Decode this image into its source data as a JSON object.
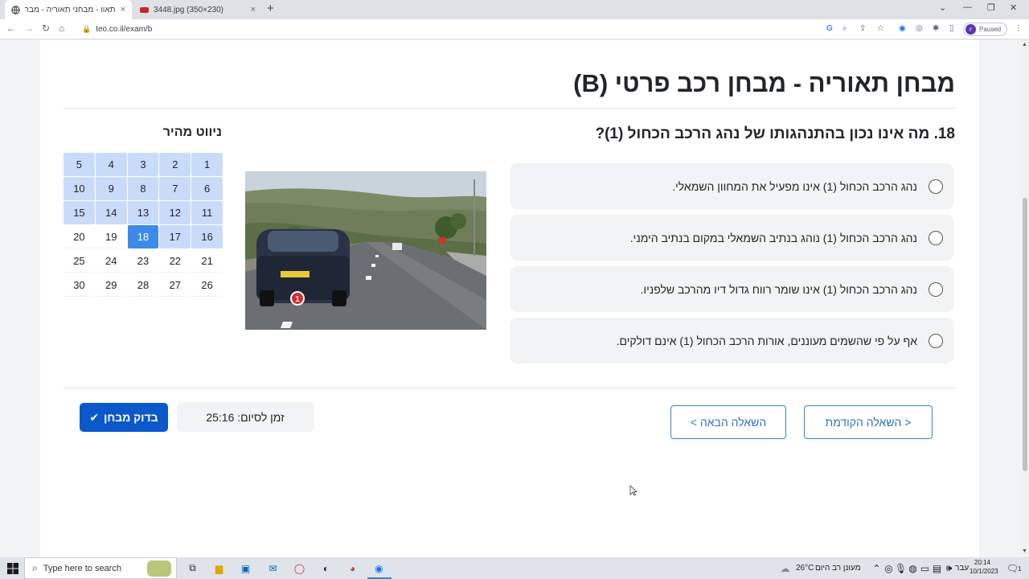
{
  "browser": {
    "tabs": [
      {
        "title": "תאוו - מבחני תאוריה - מבחן רכב",
        "close": "×"
      },
      {
        "title": "3448.jpg (350×230)",
        "close": "×"
      }
    ],
    "new_tab": "+",
    "url": "teo.co.il/exam/b",
    "profile_initial": "r",
    "profile_status": "Paused"
  },
  "page": {
    "title": "מבחן תאוריה - מבחן רכב פרטי (B)",
    "question": "18. מה אינו נכון בהתנהגותו של נהג הרכב הכחול (1)?",
    "answers": [
      "נהג הרכב הכחול (1) אינו מפעיל את המחוון השמאלי.",
      "נהג הרכב הכחול (1) נוהג בנתיב השמאלי במקום בנתיב הימני.",
      "נהג הרכב הכחול (1) אינו שומר רווח גדול דיו מהרכב שלפניו.",
      "אף על פי שהשמים מעוננים, אורות הרכב הכחול (1) אינם דולקים."
    ],
    "image_marker": "1",
    "quick_nav_title": "ניווט מהיר",
    "quick_nav": [
      [
        "1",
        "2",
        "3",
        "4",
        "5"
      ],
      [
        "6",
        "7",
        "8",
        "9",
        "10"
      ],
      [
        "11",
        "12",
        "13",
        "14",
        "15"
      ],
      [
        "16",
        "17",
        "18",
        "19",
        "20"
      ],
      [
        "21",
        "22",
        "23",
        "24",
        "25"
      ],
      [
        "26",
        "27",
        "28",
        "29",
        "30"
      ]
    ],
    "current_question": 18,
    "answered_through": 17,
    "prev_button": "< השאלה הקודמת",
    "next_button": "השאלה הבאה >",
    "timer": "זמן לסיום: 25:16",
    "check_button": "בדוק מבחן"
  },
  "taskbar": {
    "search_placeholder": "Type here to search",
    "weather_temp": "26°C",
    "weather_text": "מעונן רב היום",
    "lang": "עבר",
    "time": "20:14",
    "date": "10/1/2023",
    "notifications": "1"
  },
  "colors": {
    "primary": "#0a58ca",
    "current_cell": "#3b8beb",
    "answered_cell": "#c8dcfa",
    "outline": "#3b7fd1"
  }
}
